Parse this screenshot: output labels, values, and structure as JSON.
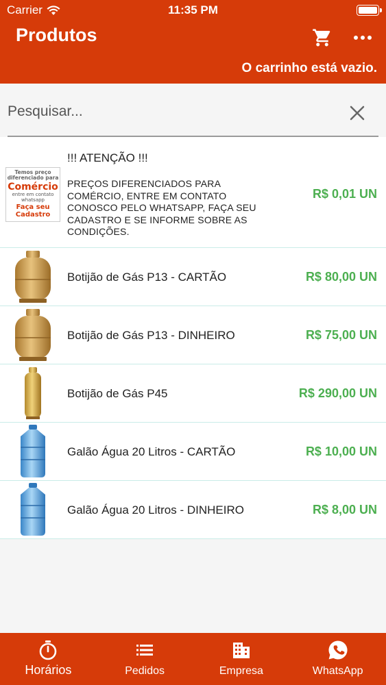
{
  "status_bar": {
    "carrier": "Carrier",
    "time": "11:35 PM"
  },
  "app_bar": {
    "title": "Produtos",
    "cart_status": "O carrinho está vazio.",
    "cart_icon": "cart-icon",
    "more_icon": "more-horizontal-icon"
  },
  "search": {
    "placeholder": "Pesquisar...",
    "value": ""
  },
  "attention": {
    "title": "!!! ATENÇÃO !!!",
    "text": "PREÇOS DIFERENCIADOS PARA COMÉRCIO, ENTRE EM CONTATO CONOSCO PELO WHATSAPP, FAÇA SEU CADASTRO E SE INFORME SOBRE AS CONDIÇÕES.",
    "price": "R$ 0,01 UN",
    "image": {
      "line1": "Temos preço diferenciado para",
      "line2": "Comércio",
      "line3": "entre em contato whatsapp",
      "line4": "Faça seu Cadastro"
    }
  },
  "products": [
    {
      "name": "Botijão de Gás P13 - CARTÃO",
      "price": "R$ 80,00 UN",
      "image": "gas-p13"
    },
    {
      "name": "Botijão de Gás P13 - DINHEIRO",
      "price": "R$ 75,00 UN",
      "image": "gas-p13"
    },
    {
      "name": "Botijão de Gás P45",
      "price": "R$ 290,00 UN",
      "image": "gas-p45"
    },
    {
      "name": "Galão Água 20 Litros - CARTÃO",
      "price": "R$ 10,00 UN",
      "image": "water-jug"
    },
    {
      "name": "Galão Água 20 Litros - DINHEIRO",
      "price": "R$ 8,00 UN",
      "image": "water-jug"
    }
  ],
  "tabs": [
    {
      "label": "Horários",
      "icon": "stopwatch-icon",
      "active": true
    },
    {
      "label": "Pedidos",
      "icon": "list-icon"
    },
    {
      "label": "Empresa",
      "icon": "building-icon"
    },
    {
      "label": "WhatsApp",
      "icon": "whatsapp-icon"
    }
  ],
  "colors": {
    "primary": "#d63b09",
    "price": "#4caf50",
    "divider": "#c9ece8"
  }
}
